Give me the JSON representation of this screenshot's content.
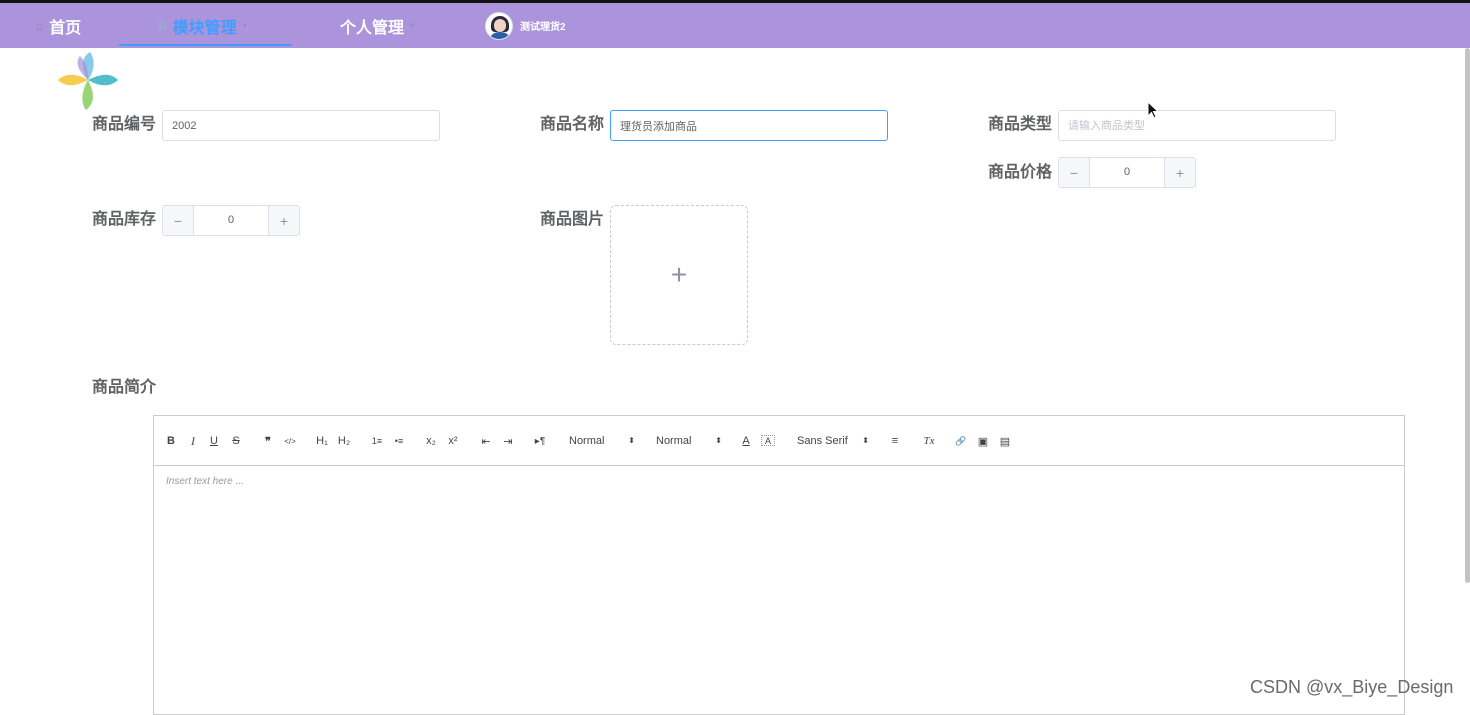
{
  "nav": {
    "home": "首页",
    "module": "模块管理",
    "personal": "个人管理",
    "username": "测试理货2"
  },
  "form": {
    "code_label": "商品编号",
    "code_value": "2002",
    "name_label": "商品名称",
    "name_value": "理货员添加商品",
    "type_label": "商品类型",
    "type_placeholder": "请输入商品类型",
    "price_label": "商品价格",
    "price_value": "0",
    "stock_label": "商品库存",
    "stock_value": "0",
    "image_label": "商品图片",
    "intro_label": "商品简介"
  },
  "editor": {
    "placeholder": "Insert text here ...",
    "header_picker": "Normal",
    "size_picker": "Normal",
    "font_picker": "Sans Serif",
    "buttons": {
      "bold": "B",
      "italic": "I",
      "underline": "U",
      "strike": "S",
      "blockquote": "❞",
      "code": "</>",
      "h1": "H₁",
      "h2": "H₂",
      "ordered_list": "1≡",
      "bullet_list": "•≡",
      "subscript": "x₂",
      "superscript": "x²",
      "outdent": "⇤",
      "indent": "⇥",
      "direction": "▸¶",
      "color": "A",
      "background": "A",
      "align": "≡",
      "clean": "Tx",
      "link": "🔗",
      "image": "▣",
      "video": "▤"
    }
  },
  "watermark": "CSDN @vx_Biye_Design",
  "colors": {
    "navbar": "#ab94dc",
    "active": "#409eff"
  }
}
